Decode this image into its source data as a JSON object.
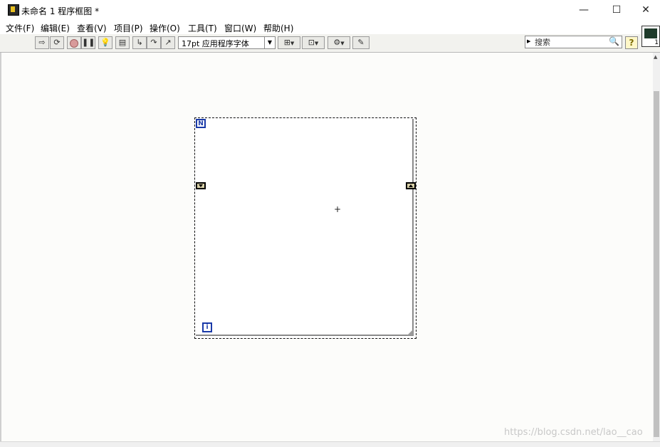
{
  "window": {
    "title": "未命名 1 程序框图 *",
    "minimize": "—",
    "maximize": "☐",
    "close": "✕"
  },
  "menu": [
    "文件(F)",
    "编辑(E)",
    "查看(V)",
    "项目(P)",
    "操作(O)",
    "工具(T)",
    "窗口(W)",
    "帮助(H)"
  ],
  "toolbar": {
    "font": "17pt 应用程序字体",
    "search_placeholder": "搜索",
    "help": "?",
    "icons": [
      "run-arrow",
      "run-continuously",
      "abort",
      "pause",
      "highlight-execution",
      "retain-wire-values",
      "step-into",
      "step-over",
      "step-out",
      "align-objects",
      "distribute-objects",
      "reorder",
      "cleanup-diagram"
    ]
  },
  "vi_icon_number": "1",
  "diagram": {
    "structure": "for-loop",
    "count_terminal": "N",
    "iteration_terminal": "i"
  },
  "watermark": "https://blog.csdn.net/lao__cao"
}
